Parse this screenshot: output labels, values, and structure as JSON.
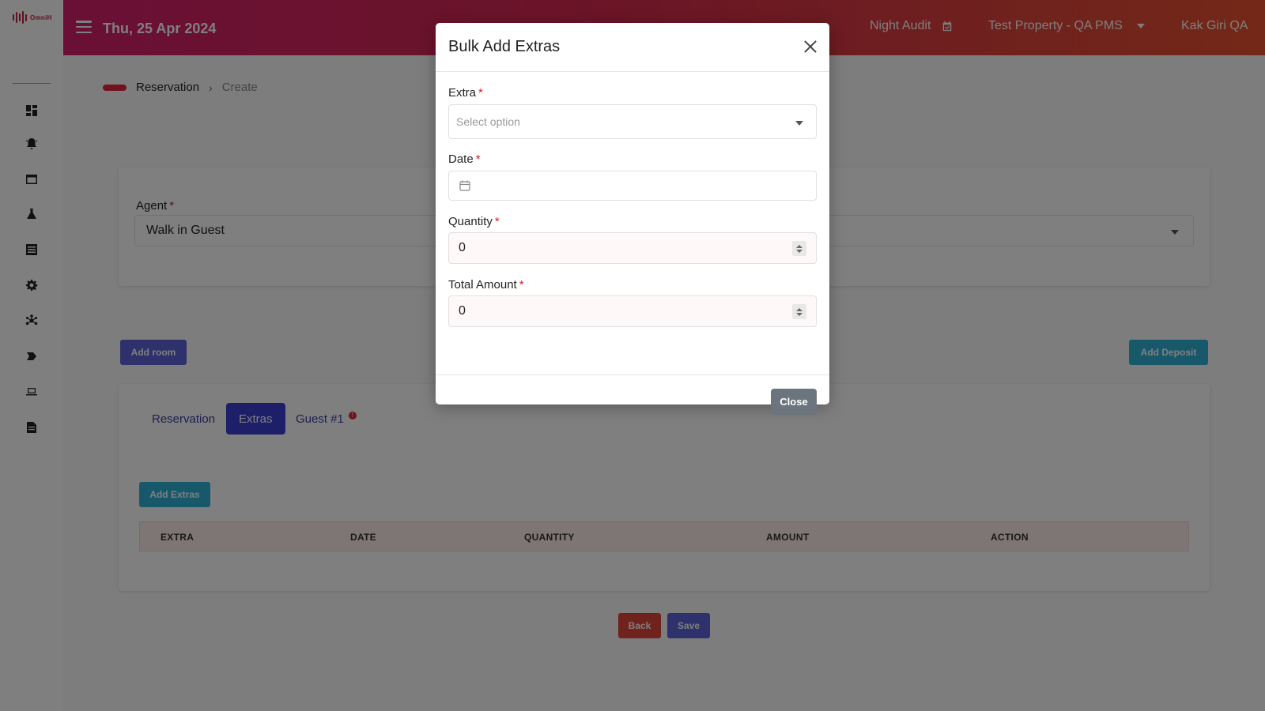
{
  "logo": {
    "text": "OmniH"
  },
  "topbar": {
    "date": "Thu, 25 Apr 2024",
    "night_audit": "Night Audit",
    "property": "Test Property - QA PMS",
    "user": "Kak Giri QA"
  },
  "sidebar": {
    "icons": [
      "dashboard-icon",
      "bell-icon",
      "window-icon",
      "flask-icon",
      "list-icon",
      "gear-icon",
      "network-icon",
      "tag-icon",
      "laptop-icon",
      "report-icon"
    ]
  },
  "breadcrumb": {
    "section": "Reservation",
    "page": "Create"
  },
  "agent": {
    "label": "Agent",
    "value": "Walk in Guest"
  },
  "buttons": {
    "add_room": "Add room",
    "add_deposit": "Add Deposit",
    "add_extras": "Add Extras",
    "back": "Back",
    "save": "Save"
  },
  "tabs": [
    {
      "label": "Reservation",
      "active": false
    },
    {
      "label": "Extras",
      "active": true
    },
    {
      "label": "Guest #1",
      "active": false,
      "alert": "!"
    }
  ],
  "extras_table": {
    "columns": [
      "EXTRA",
      "DATE",
      "QUANTITY",
      "AMOUNT",
      "ACTION"
    ]
  },
  "modal": {
    "title": "Bulk Add Extras",
    "extra_label": "Extra",
    "extra_placeholder": "Select option",
    "date_label": "Date",
    "quantity_label": "Quantity",
    "quantity_value": "0",
    "total_label": "Total Amount",
    "total_value": "0",
    "required_mark": "*",
    "close_button": "Close"
  },
  "colors": {
    "topbar_start": "#d4206c",
    "topbar_end": "#e8512e",
    "primary": "#5d62d6",
    "info": "#2fb3d7",
    "danger": "#e0453a",
    "secondary": "#6c757d"
  }
}
